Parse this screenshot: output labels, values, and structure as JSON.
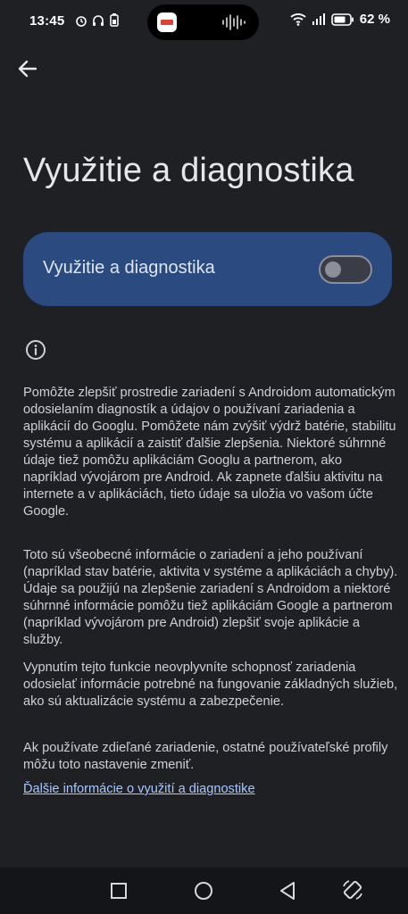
{
  "status_bar": {
    "time": "13:45",
    "battery": "62 %"
  },
  "header": {
    "title": "Využitie a diagnostika"
  },
  "toggle": {
    "label": "Využitie a diagnostika",
    "state": "off"
  },
  "info": {
    "paragraphs": [
      "Pomôžte zlepšiť prostredie zariadení s Androidom automatickým odosielaním diagnostík a údajov o používaní zariadenia a aplikácií do Googlu. Pomôžete nám zvýšiť výdrž batérie, stabilitu systému a aplikácií a zaistiť ďalšie zlepšenia. Niektoré súhrnné údaje tiež pomôžu aplikáciám Googlu a partnerom, ako napríklad vývojárom pre Android. Ak zapnete ďalšiu aktivitu na internete a v aplikáciách, tieto údaje sa uložia vo vašom účte Google.",
      "Toto sú všeobecné informácie o zariadení a jeho používaní (napríklad stav batérie, aktivita v systéme a aplikáciách a chyby). Údaje sa použijú na zlepšenie zariadení s Androidom a niektoré súhrnné informácie pomôžu tiež aplikáciám Google a partnerom (napríklad vývojárom pre Android) zlepšiť svoje aplikácie a služby.",
      "Vypnutím tejto funkcie neovplyvníte schopnosť zariadenia odosielať informácie potrebné na fungovanie základných služieb, ako sú aktualizácie systému a zabezpečenie.",
      "Ak používate zdieľané zariadenie, ostatné používateľské profily môžu toto nastavenie zmeniť."
    ],
    "link": "Ďalšie informácie o využití a diagnostike"
  },
  "icons": {
    "back": "arrow-left-icon",
    "info": "info-circle-icon",
    "nav": [
      "recents-square-icon",
      "home-circle-icon",
      "back-triangle-icon",
      "rotate-icon"
    ]
  }
}
